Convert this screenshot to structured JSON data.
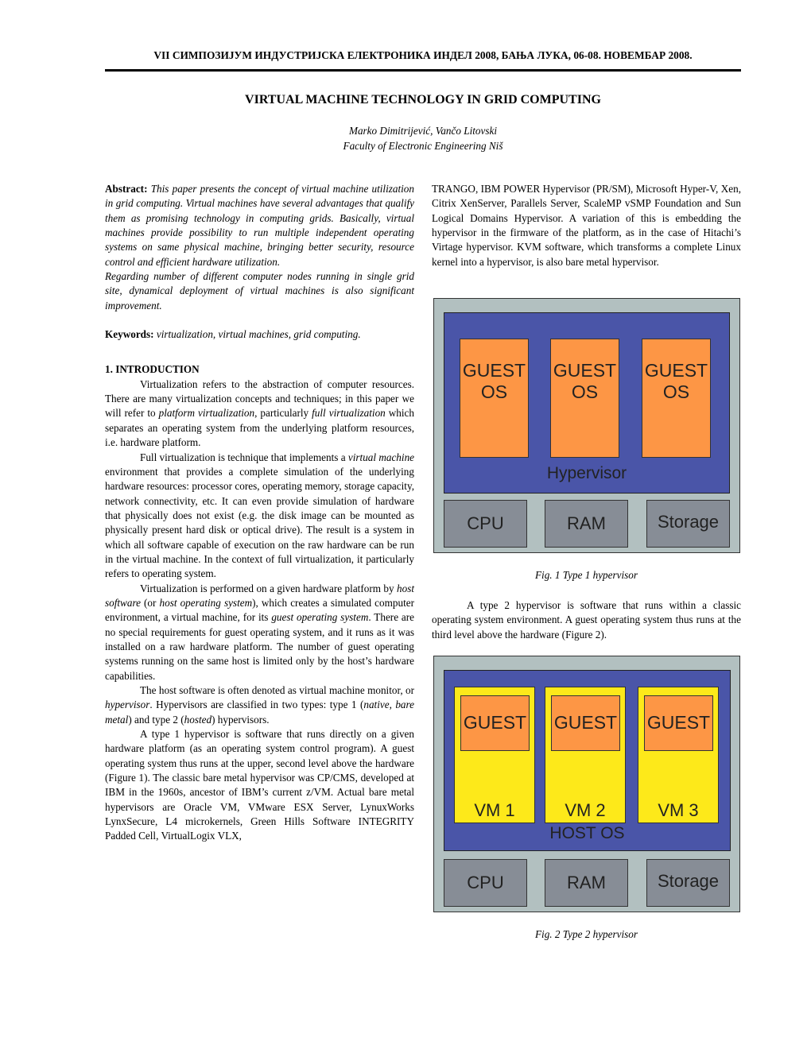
{
  "header": {
    "running_head": "VII СИМПОЗИЈУМ ИНДУСТРИЈСКА ЕЛЕКТРОНИКА ИНДЕЛ 2008, БАЊА ЛУКА, 06-08. НОВЕМБАР 2008."
  },
  "paper": {
    "title": "VIRTUAL MACHINE TECHNOLOGY IN GRID COMPUTING",
    "authors": "Marko Dimitrijević, Vančo Litovski",
    "affiliation": "Faculty of Electronic Engineering Niš"
  },
  "abstract": {
    "label": "Abstract:",
    "text": "This paper presents the concept of virtual machine utilization in grid computing. Virtual machines have several advantages that qualify them as promising technology in computing grids. Basically, virtual machines provide possibility to run multiple independent operating systems on same physical machine, bringing better security, resource control and efficient hardware utilization.",
    "text2": "Regarding number of different computer nodes running in single grid site, dynamical deployment of virtual machines is also significant improvement."
  },
  "keywords": {
    "label": "Keywords:",
    "text": "virtualization, virtual machines, grid computing."
  },
  "intro": {
    "heading": "1. INTRODUCTION",
    "p1": {
      "a": "Virtualization refers to the abstraction of computer resources. There are many virtualization concepts and techniques; in this paper we will refer to ",
      "i1": "platform virtualization",
      "b": ", particularly ",
      "i2": "full virtualization",
      "c": " which separates an operating system from the underlying platform resources, i.e. hardware platform."
    },
    "p2": {
      "a": "Full virtualization is technique that implements a ",
      "i1": "virtual machine",
      "b": " environment that provides a complete simulation of the underlying hardware resources: processor cores, operating memory, storage capacity, network connectivity, etc. It can even provide simulation of hardware that physically does not exist (e.g. the disk image can be mounted as physically present hard disk or optical drive). The result is a system in which all software capable of execution on the raw hardware can be run in the virtual machine. In the context of full virtualization, it particularly refers to operating system."
    },
    "p3": {
      "a": "Virtualization is performed on a given hardware platform by ",
      "i1": "host software",
      "b": " (or ",
      "i2": "host operating system",
      "c": "), which creates a simulated computer environment, a virtual machine, for its ",
      "i3": "guest operating system",
      "d": ". There are no special requirements for guest operating system, and it runs as it was installed on a raw hardware platform. The number of guest operating systems running on the same host is limited only by the host’s hardware capabilities."
    },
    "p4": {
      "a": "The host software is often denoted as virtual machine monitor, or ",
      "i1": "hypervisor",
      "b": ". Hypervisors are classified in two types: type 1 (",
      "i2": "native, bare metal",
      "c": ") and type 2 (",
      "i3": "hosted",
      "d": ") hypervisors."
    },
    "p5": "A type 1 hypervisor is software that runs directly on a given hardware platform (as an operating system control program). A guest operating system thus runs at the upper, second level above the hardware (Figure 1). The classic bare metal hypervisor was CP/CMS, developed at IBM in the 1960s, ancestor of IBM’s current z/VM. Actual bare metal hypervisors are Oracle VM, VMware ESX Server, LynuxWorks LynxSecure, L4 microkernels, Green Hills Software INTEGRITY Padded Cell, VirtualLogix VLX,",
    "p6": "TRANGO, IBM POWER Hypervisor (PR/SM), Microsoft Hyper-V, Xen, Citrix XenServer, Parallels Server, ScaleMP vSMP Foundation and Sun Logical Domains Hypervisor. A variation of this is embedding the hypervisor in the firmware of the platform, as in the case of Hitachi’s Virtage hypervisor. KVM software, which transforms a complete Linux kernel into a hypervisor, is also bare metal hypervisor.",
    "p7": "A type 2 hypervisor is software that runs within a classic operating system environment. A guest operating system thus runs at the third level above the hardware (Figure 2)."
  },
  "figure1": {
    "caption": "Fig. 1 Type 1 hypervisor",
    "guests": [
      {
        "line1": "GUEST",
        "line2": "OS"
      },
      {
        "line1": "GUEST",
        "line2": "OS"
      },
      {
        "line1": "GUEST",
        "line2": "OS"
      }
    ],
    "layer_label": "Hypervisor",
    "hardware": [
      "CPU",
      "RAM",
      "Storage"
    ]
  },
  "figure2": {
    "caption": "Fig. 2 Type 2 hypervisor",
    "vms": [
      {
        "guest": "GUEST",
        "label": "VM 1"
      },
      {
        "guest": "GUEST",
        "label": "VM 2"
      },
      {
        "guest": "GUEST",
        "label": "VM 3"
      }
    ],
    "layer_label": "HOST OS",
    "hardware": [
      "CPU",
      "RAM",
      "Storage"
    ]
  },
  "colors": {
    "frame": "#b2c0c0",
    "layer": "#4a55a8",
    "guest": "#fd9645",
    "vm": "#fde91a",
    "hardware": "#878d96"
  }
}
